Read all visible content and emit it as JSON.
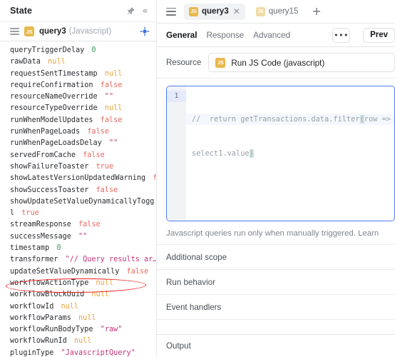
{
  "left_panel": {
    "title": "State",
    "pin_icon": "pin-icon",
    "collapse_icon": "chevron-double-left-icon",
    "subheader": {
      "menu_icon": "hamburger-icon",
      "badge": "JS",
      "name": "query3",
      "language": "(Javascript)",
      "target_icon": "crosshair-icon"
    },
    "tree": [
      {
        "key": "queryTriggerDelay",
        "value": "0",
        "type": "num"
      },
      {
        "key": "rawData",
        "value": "null",
        "type": "null"
      },
      {
        "key": "requestSentTimestamp",
        "value": "null",
        "type": "null"
      },
      {
        "key": "requireConfirmation",
        "value": "false",
        "type": "bool"
      },
      {
        "key": "resourceNameOverride",
        "value": "\"\"",
        "type": "str"
      },
      {
        "key": "resourceTypeOverride",
        "value": "null",
        "type": "null"
      },
      {
        "key": "runWhenModelUpdates",
        "value": "false",
        "type": "bool"
      },
      {
        "key": "runWhenPageLoads",
        "value": "false",
        "type": "bool"
      },
      {
        "key": "runWhenPageLoadsDelay",
        "value": "\"\"",
        "type": "str"
      },
      {
        "key": "servedFromCache",
        "value": "false",
        "type": "bool"
      },
      {
        "key": "showFailureToaster",
        "value": "true",
        "type": "bool"
      },
      {
        "key": "showLatestVersionUpdatedWarning",
        "value": "f.",
        "type": "bool"
      },
      {
        "key": "showSuccessToaster",
        "value": "false",
        "type": "bool"
      },
      {
        "key": "showUpdateSetValueDynamicallyToggl",
        "value": "true",
        "type": "bool",
        "wrap": true
      },
      {
        "key": "streamResponse",
        "value": "false",
        "type": "bool"
      },
      {
        "key": "successMessage",
        "value": "\"\"",
        "type": "str"
      },
      {
        "key": "timestamp",
        "value": "0",
        "type": "num"
      },
      {
        "key": "transformer",
        "value": "\"// Query results ar…",
        "type": "str"
      },
      {
        "key": "updateSetValueDynamically",
        "value": "false",
        "type": "bool",
        "annotated": true
      },
      {
        "key": "workflowActionType",
        "value": "null",
        "type": "null"
      },
      {
        "key": "workflowBlockUuid",
        "value": "null",
        "type": "null"
      },
      {
        "key": "workflowId",
        "value": "null",
        "type": "null"
      },
      {
        "key": "workflowParams",
        "value": "null",
        "type": "null"
      },
      {
        "key": "workflowRunBodyType",
        "value": "\"raw\"",
        "type": "str"
      },
      {
        "key": "workflowRunId",
        "value": "null",
        "type": "null"
      },
      {
        "key": "pluginType",
        "value": "\"JavascriptQuery\"",
        "type": "str"
      }
    ]
  },
  "right_panel": {
    "tabbar": {
      "menu_icon": "hamburger-icon",
      "tabs": [
        {
          "badge": "JS",
          "label": "query3",
          "active": true,
          "close_icon": "close-icon"
        },
        {
          "badge": "JS",
          "label": "query15",
          "active": false
        }
      ],
      "add_icon": "plus-icon"
    },
    "subtabs": [
      {
        "label": "General",
        "active": true
      },
      {
        "label": "Response",
        "active": false
      },
      {
        "label": "Advanced",
        "active": false
      }
    ],
    "more_button": "•••",
    "preview_button": "Prev",
    "resource": {
      "label": "Resource",
      "badge": "JS",
      "value": "Run JS Code (javascript)"
    },
    "editor": {
      "line_number": "1",
      "code_line_1_a": "//  return getTransactions.data.filter",
      "code_line_1_sel": "(",
      "code_line_1_b": "row => ro",
      "code_line_2": "select1.value",
      "code_line_2_sel": ")"
    },
    "helper_text": "Javascript queries run only when manually triggered. Learn",
    "sections": [
      {
        "label": "Additional scope"
      },
      {
        "label": "Run behavior"
      },
      {
        "label": "Event handlers"
      }
    ],
    "output_label": "Output"
  },
  "colors": {
    "accent_blue": "#4d7ff0",
    "badge_yellow": "#e8b94b",
    "annotation_red": "#f01c1c",
    "string_pink": "#c2357a",
    "null_orange": "#e8a33d",
    "bool_red": "#e8685e",
    "number_green": "#3f9a5d"
  }
}
